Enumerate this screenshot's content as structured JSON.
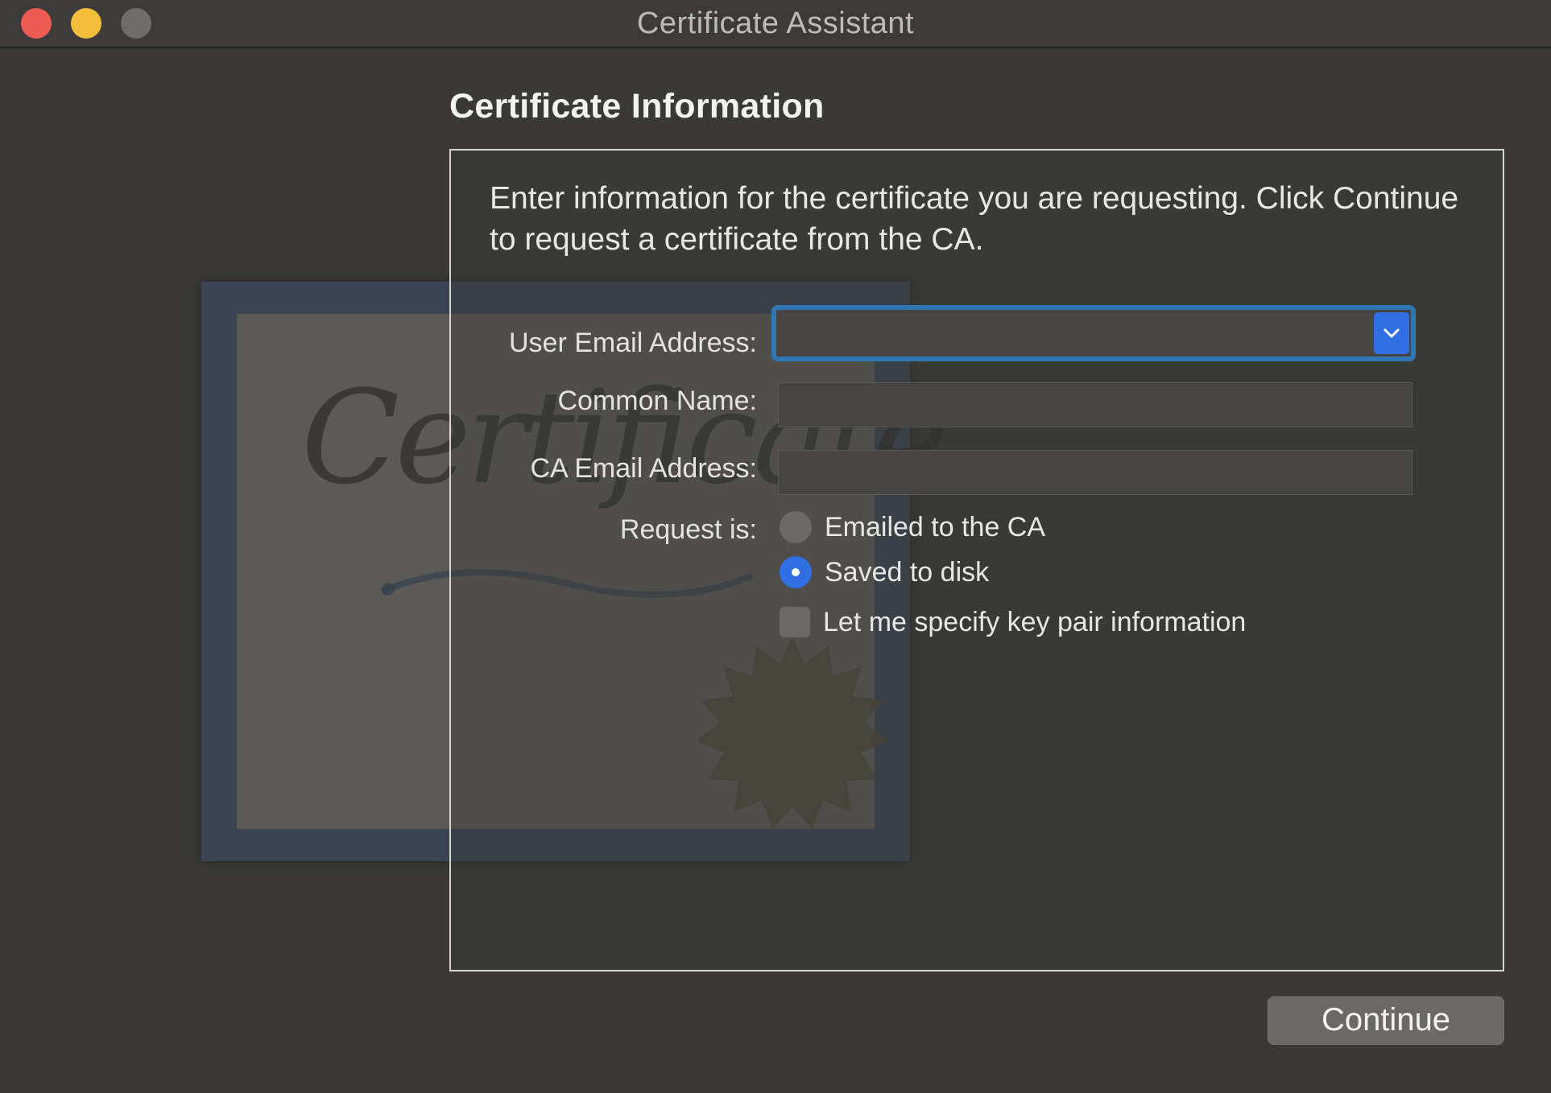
{
  "window": {
    "title": "Certificate Assistant",
    "controls": {
      "close_color": "#ee5b52",
      "minimize_color": "#f4be3a",
      "zoom_color": "#6e6d6b"
    }
  },
  "graphic": {
    "watermark_text": "Certificate",
    "seal_icon": "seal-icon"
  },
  "section": {
    "title": "Certificate Information",
    "intro": "Enter information for the certificate you are requesting. Click Continue to request a certificate from the CA."
  },
  "form": {
    "user_email": {
      "label": "User Email Address:",
      "value": "",
      "dropdown_icon": "chevron-down-icon"
    },
    "common_name": {
      "label": "Common Name:",
      "value": ""
    },
    "ca_email": {
      "label": "CA Email Address:",
      "value": ""
    },
    "request": {
      "label": "Request is:",
      "options": [
        {
          "label": "Emailed to the CA",
          "selected": false
        },
        {
          "label": "Saved to disk",
          "selected": true
        }
      ]
    },
    "key_pair": {
      "label": "Let me specify key pair information",
      "checked": false
    }
  },
  "footer": {
    "continue_label": "Continue"
  },
  "colors": {
    "accent": "#2f6fe3",
    "focus_ring": "#2f76b5",
    "background": "#3a3937"
  }
}
